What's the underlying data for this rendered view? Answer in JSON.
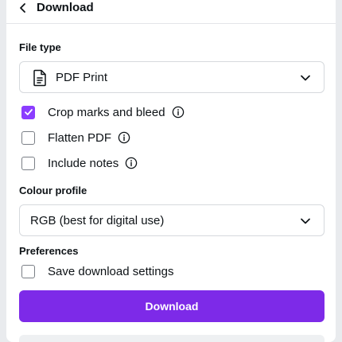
{
  "header": {
    "title": "Download"
  },
  "file_type": {
    "label": "File type",
    "value": "PDF Print"
  },
  "options": [
    {
      "label": "Crop marks and bleed",
      "checked": true
    },
    {
      "label": "Flatten PDF",
      "checked": false
    },
    {
      "label": "Include notes",
      "checked": false
    }
  ],
  "colour_profile": {
    "label": "Colour profile",
    "value": "RGB (best for digital use)"
  },
  "preferences": {
    "label": "Preferences",
    "save_settings_label": "Save download settings",
    "save_settings_checked": false
  },
  "download_button": {
    "label": "Download"
  },
  "colors": {
    "accent": "#7d2ae8",
    "checkbox_on": "#8b3dff"
  }
}
